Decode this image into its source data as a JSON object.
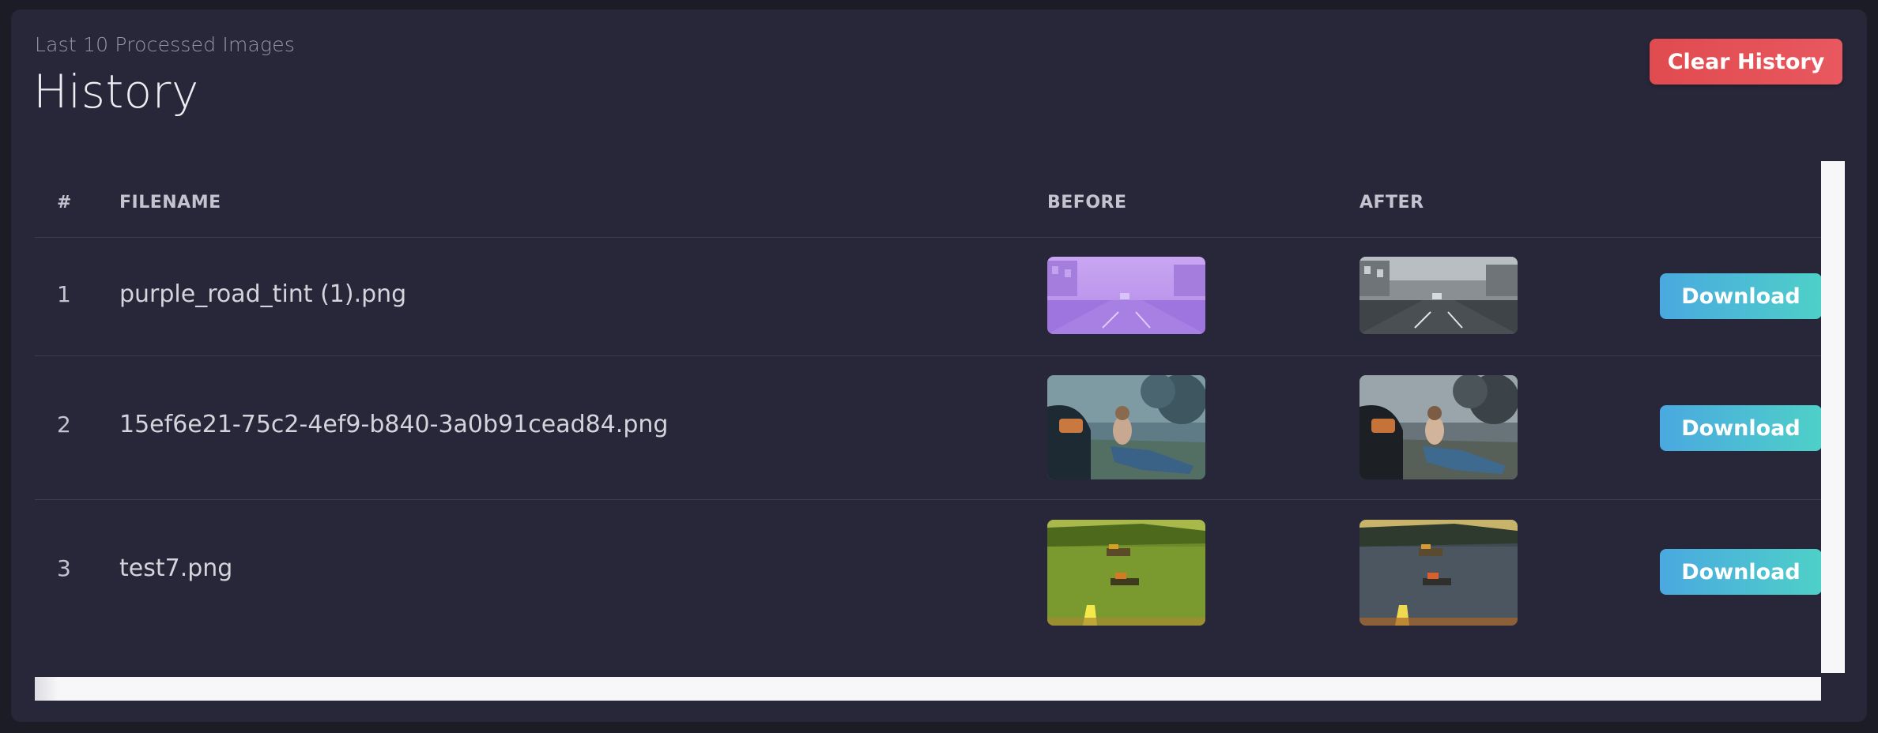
{
  "header": {
    "subtitle": "Last 10 Processed Images",
    "title": "History",
    "clear_label": "Clear History"
  },
  "table": {
    "columns": [
      "#",
      "FILENAME",
      "BEFORE",
      "AFTER"
    ],
    "rows": [
      {
        "index": "1",
        "filename": "purple_road_tint (1).png",
        "download_label": "Download"
      },
      {
        "index": "2",
        "filename": "15ef6e21-75c2-4ef9-b840-3a0b91cead84.png",
        "download_label": "Download"
      },
      {
        "index": "3",
        "filename": "test7.png",
        "download_label": "Download"
      }
    ]
  },
  "colors": {
    "background": "#1c1c26",
    "card": "#272739",
    "clear_button": "#e04b4f",
    "download_button_start": "#4aa9e0",
    "download_button_end": "#4ed0c8"
  }
}
